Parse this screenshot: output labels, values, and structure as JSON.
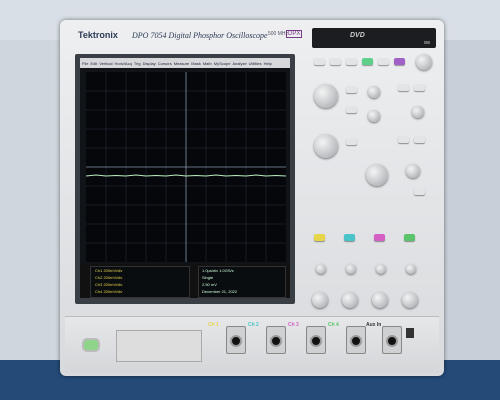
{
  "device": {
    "brand": "Tektronix",
    "model": "DPO 7054  Digital Phosphor Oscilloscope",
    "bandwidth": "500 MHz",
    "badge": "DPX"
  },
  "dvd": {
    "label": "DVD"
  },
  "screen": {
    "menu": [
      "File",
      "Edit",
      "Vertical",
      "Horiz/Acq",
      "Trig",
      "Display",
      "Cursors",
      "Measure",
      "Mask",
      "Math",
      "MyScope",
      "Analyze",
      "Utilities",
      "Help"
    ],
    "readout_left": [
      "Ch1  200mV/div",
      "Ch2  200mV/div",
      "Ch3  200mV/div",
      "Ch4  200mV/div"
    ],
    "readout_right": [
      "1.0µs/div  1.0GS/s",
      "Single",
      "2.50 mV",
      "Ch1 f 0",
      "December 21, 2022"
    ]
  },
  "channels": [
    {
      "label": "Ch 1",
      "color": "#e8d64a"
    },
    {
      "label": "Ch 2",
      "color": "#49c5c9"
    },
    {
      "label": "Ch 3",
      "color": "#d45fc5"
    },
    {
      "label": "Ch 4",
      "color": "#5bc46a"
    },
    {
      "label": "Aux In",
      "color": "#333333"
    }
  ]
}
